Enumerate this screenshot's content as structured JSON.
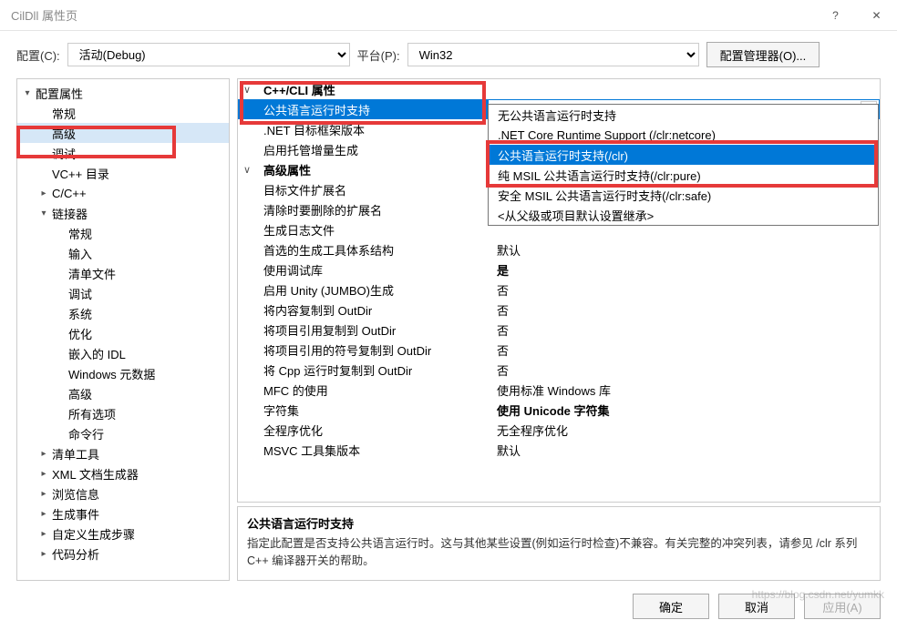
{
  "window": {
    "title": "CilDll 属性页",
    "help_icon": "?",
    "close_icon": "✕"
  },
  "toolbar": {
    "config_label": "配置(C):",
    "config_value": "活动(Debug)",
    "platform_label": "平台(P):",
    "platform_value": "Win32",
    "config_mgr": "配置管理器(O)..."
  },
  "tree": [
    {
      "label": "配置属性",
      "level": 0,
      "caret": "open"
    },
    {
      "label": "常规",
      "level": 1,
      "caret": "none"
    },
    {
      "label": "高级",
      "level": 1,
      "caret": "none",
      "selected": true
    },
    {
      "label": "调试",
      "level": 1,
      "caret": "none"
    },
    {
      "label": "VC++ 目录",
      "level": 1,
      "caret": "none"
    },
    {
      "label": "C/C++",
      "level": 1,
      "caret": "closed"
    },
    {
      "label": "链接器",
      "level": 1,
      "caret": "open"
    },
    {
      "label": "常规",
      "level": 2,
      "caret": "none"
    },
    {
      "label": "输入",
      "level": 2,
      "caret": "none"
    },
    {
      "label": "清单文件",
      "level": 2,
      "caret": "none"
    },
    {
      "label": "调试",
      "level": 2,
      "caret": "none"
    },
    {
      "label": "系统",
      "level": 2,
      "caret": "none"
    },
    {
      "label": "优化",
      "level": 2,
      "caret": "none"
    },
    {
      "label": "嵌入的 IDL",
      "level": 2,
      "caret": "none"
    },
    {
      "label": "Windows 元数据",
      "level": 2,
      "caret": "none"
    },
    {
      "label": "高级",
      "level": 2,
      "caret": "none"
    },
    {
      "label": "所有选项",
      "level": 2,
      "caret": "none"
    },
    {
      "label": "命令行",
      "level": 2,
      "caret": "none"
    },
    {
      "label": "清单工具",
      "level": 1,
      "caret": "closed"
    },
    {
      "label": "XML 文档生成器",
      "level": 1,
      "caret": "closed"
    },
    {
      "label": "浏览信息",
      "level": 1,
      "caret": "closed"
    },
    {
      "label": "生成事件",
      "level": 1,
      "caret": "closed"
    },
    {
      "label": "自定义生成步骤",
      "level": 1,
      "caret": "closed"
    },
    {
      "label": "代码分析",
      "level": 1,
      "caret": "closed"
    }
  ],
  "props": {
    "group1": "C++/CLI 属性",
    "clr_support_label": "公共语言运行时支持",
    "clr_support_value": "公共语言运行时支持(/clr)",
    "target_fw_label": ".NET 目标框架版本",
    "managed_incr_label": "启用托管增量生成",
    "group2": "高级属性",
    "rows": [
      {
        "name": "目标文件扩展名",
        "value": ""
      },
      {
        "name": "清除时要删除的扩展名",
        "value": ""
      },
      {
        "name": "生成日志文件",
        "value": ""
      },
      {
        "name": "首选的生成工具体系结构",
        "value": "默认"
      },
      {
        "name": "使用调试库",
        "value": "是",
        "bold": true
      },
      {
        "name": "启用 Unity (JUMBO)生成",
        "value": "否"
      },
      {
        "name": "将内容复制到 OutDir",
        "value": "否"
      },
      {
        "name": "将项目引用复制到 OutDir",
        "value": "否"
      },
      {
        "name": "将项目引用的符号复制到 OutDir",
        "value": "否"
      },
      {
        "name": "将 Cpp 运行时复制到 OutDir",
        "value": "否"
      },
      {
        "name": "MFC 的使用",
        "value": "使用标准 Windows 库"
      },
      {
        "name": "字符集",
        "value": "使用 Unicode 字符集",
        "bold": true
      },
      {
        "name": "全程序优化",
        "value": "无全程序优化"
      },
      {
        "name": "MSVC 工具集版本",
        "value": "默认"
      }
    ]
  },
  "dropdown": [
    {
      "label": "无公共语言运行时支持"
    },
    {
      "label": ".NET Core Runtime Support (/clr:netcore)"
    },
    {
      "label": "公共语言运行时支持(/clr)",
      "selected": true
    },
    {
      "label": "纯 MSIL 公共语言运行时支持(/clr:pure)"
    },
    {
      "label": "安全 MSIL 公共语言运行时支持(/clr:safe)"
    },
    {
      "label": "<从父级或项目默认设置继承>"
    }
  ],
  "description": {
    "title": "公共语言运行时支持",
    "body": "指定此配置是否支持公共语言运行时。这与其他某些设置(例如运行时检查)不兼容。有关完整的冲突列表，请参见 /clr 系列 C++ 编译器开关的帮助。"
  },
  "buttons": {
    "ok": "确定",
    "cancel": "取消",
    "apply": "应用(A)"
  },
  "watermark": "https://blog.csdn.net/yumkk"
}
